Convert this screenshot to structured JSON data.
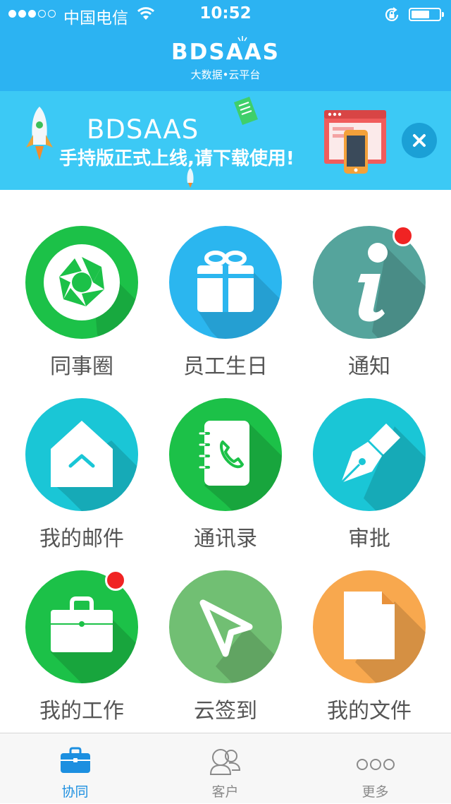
{
  "status_bar": {
    "carrier": "中国电信",
    "time": "10:52"
  },
  "brand": {
    "logo_text": "BDSAAS",
    "subtitle": "大数据•云平台"
  },
  "banner": {
    "title": "BDSAAS",
    "subtitle": "手持版正式上线,请下载使用!"
  },
  "grid": [
    {
      "label": "同事圈",
      "icon": "aperture-icon",
      "color": "#1cc148",
      "badge": false
    },
    {
      "label": "员工生日",
      "icon": "gift-icon",
      "color": "#2bb6ef",
      "badge": false
    },
    {
      "label": "通知",
      "icon": "info-icon",
      "color": "#55a49c",
      "badge": true
    },
    {
      "label": "我的邮件",
      "icon": "mail-home-icon",
      "color": "#1ac6d6",
      "badge": false
    },
    {
      "label": "通讯录",
      "icon": "contacts-book-icon",
      "color": "#1cc148",
      "badge": false
    },
    {
      "label": "审批",
      "icon": "pen-nib-icon",
      "color": "#1ac6d6",
      "badge": false
    },
    {
      "label": "我的工作",
      "icon": "briefcase-icon",
      "color": "#1cc148",
      "badge": true
    },
    {
      "label": "云签到",
      "icon": "send-arrow-icon",
      "color": "#71bf73",
      "badge": false
    },
    {
      "label": "我的文件",
      "icon": "document-icon",
      "color": "#f8a84e",
      "badge": false
    }
  ],
  "tabbar": {
    "active_color": "#1c8fe0",
    "inactive_color": "#8a8a8a",
    "tabs": [
      {
        "label": "协同",
        "icon": "briefcase-icon",
        "active": true
      },
      {
        "label": "客户",
        "icon": "people-icon",
        "active": false
      },
      {
        "label": "更多",
        "icon": "more-dots-icon",
        "active": false
      }
    ]
  }
}
